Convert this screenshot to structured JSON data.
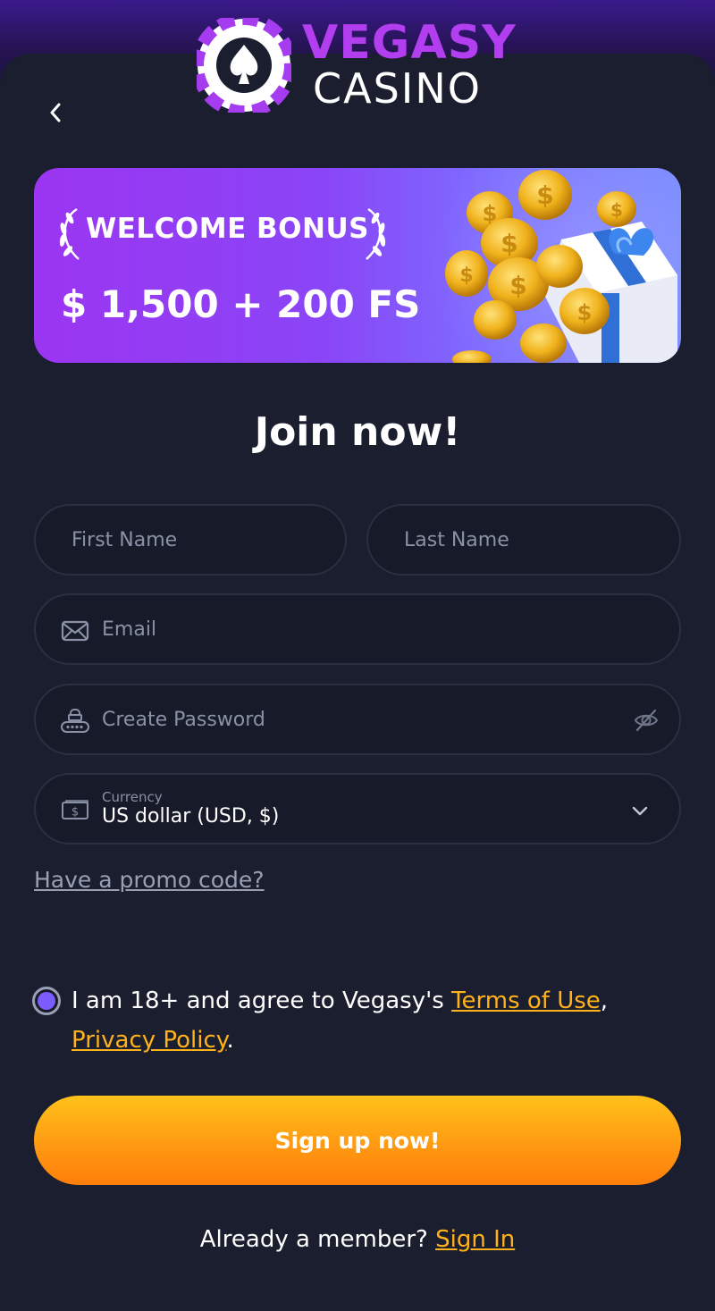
{
  "brand": {
    "name_line1": "VEGASY",
    "name_line2": "CASINO",
    "primary_color": "#b23ef0",
    "accent_color": "#ffb21a"
  },
  "nav": {
    "back_icon": "chevron-left-icon"
  },
  "banner": {
    "title": "WELCOME BONUS",
    "amount": "$ 1,500 + 200 FS"
  },
  "form": {
    "heading": "Join now!",
    "first_name": {
      "placeholder": "First Name",
      "value": ""
    },
    "last_name": {
      "placeholder": "Last Name",
      "value": ""
    },
    "email": {
      "placeholder": "Email",
      "value": "",
      "icon": "envelope-icon"
    },
    "password": {
      "placeholder": "Create Password",
      "value": "",
      "icon": "password-lock-icon",
      "toggle_icon": "eye-off-icon"
    },
    "currency": {
      "label": "Currency",
      "value": "US dollar (USD, $)",
      "icon": "banknote-icon"
    },
    "promo_link": "Have a promo code?",
    "consent": {
      "text_before": "I am 18+ and agree to Vegasy's ",
      "terms_link": "Terms of Use",
      "separator": ",",
      "privacy_link": "Privacy Policy",
      "text_after": ".",
      "checked": true
    },
    "submit_label": "Sign up now!"
  },
  "footer": {
    "member_text": "Already a member? ",
    "signin_link": "Sign In"
  }
}
